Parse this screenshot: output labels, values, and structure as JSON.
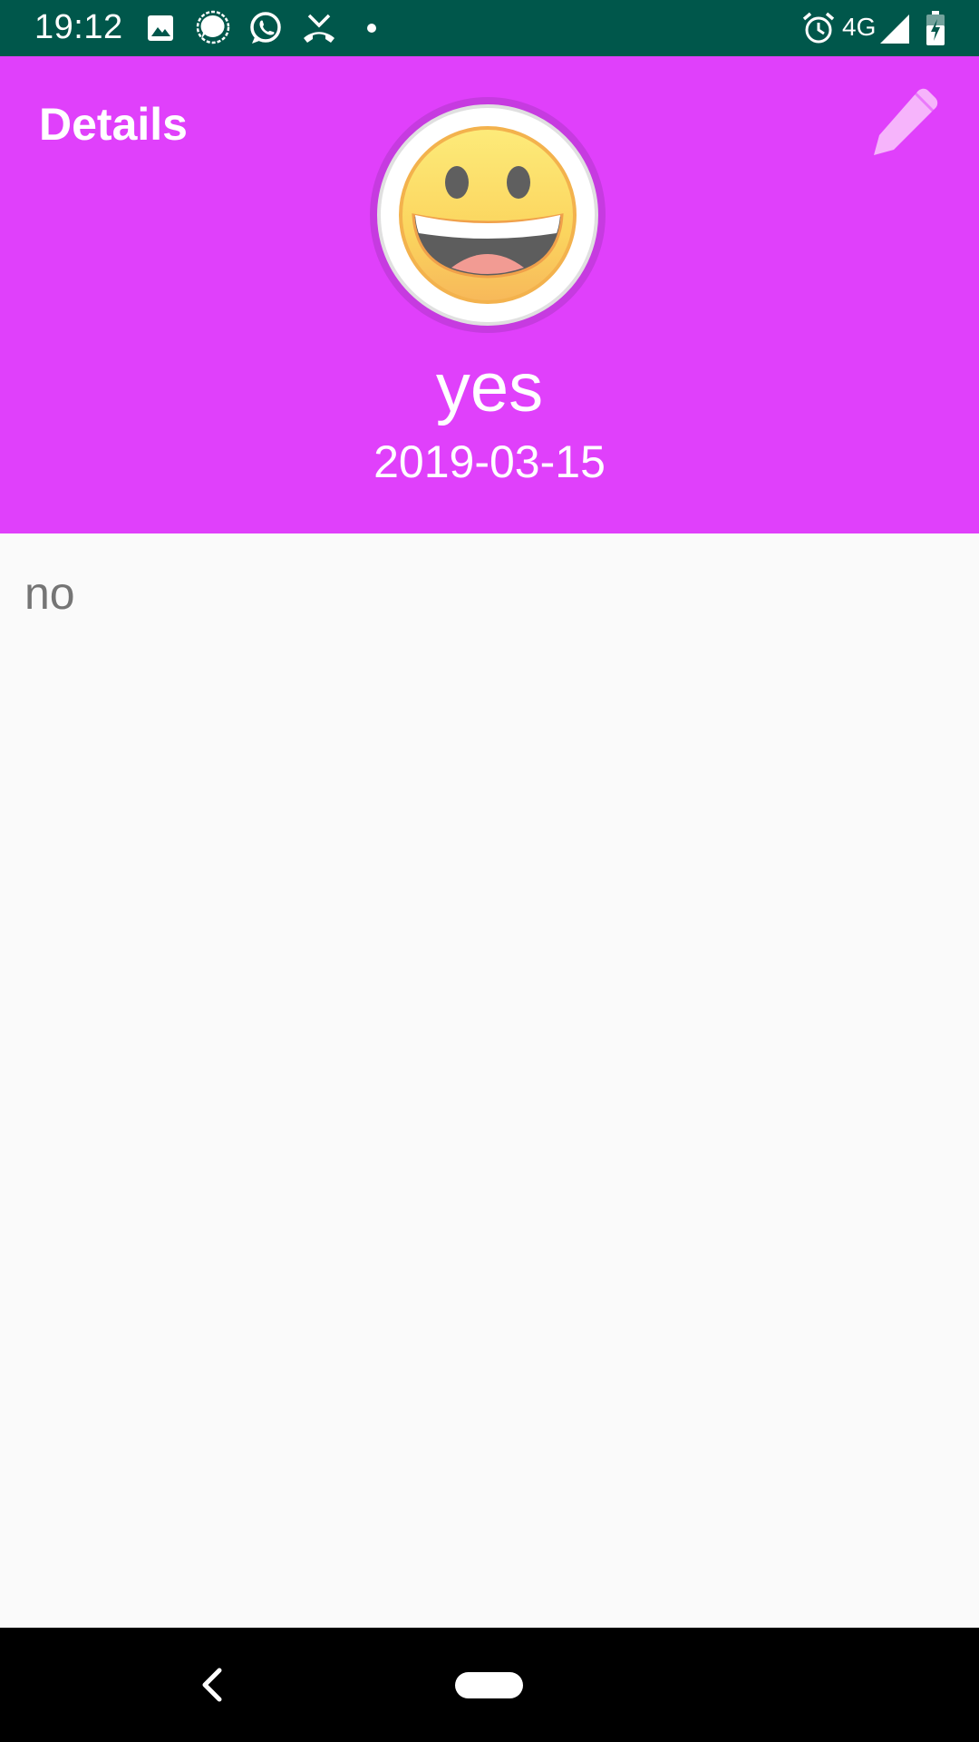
{
  "status_bar": {
    "time": "19:12",
    "network": "4G",
    "background_color": "#00574b",
    "left_icons": [
      "image-icon",
      "signal-messenger-icon",
      "whatsapp-icon",
      "missed-call-icon",
      "notification-dot-icon"
    ],
    "right_icons": [
      "alarm-icon",
      "cell-signal-icon",
      "battery-charging-icon"
    ]
  },
  "header": {
    "title": "Details",
    "background_color": "#e040fb",
    "edit_icon": "pencil-icon",
    "avatar_icon": "grinning-face-emoji",
    "entry_name": "yes",
    "entry_date": "2019-03-15"
  },
  "content": {
    "note_text": "no"
  },
  "nav_bar": {
    "back_icon": "back-chevron-icon",
    "home_icon": "home-pill-icon"
  }
}
